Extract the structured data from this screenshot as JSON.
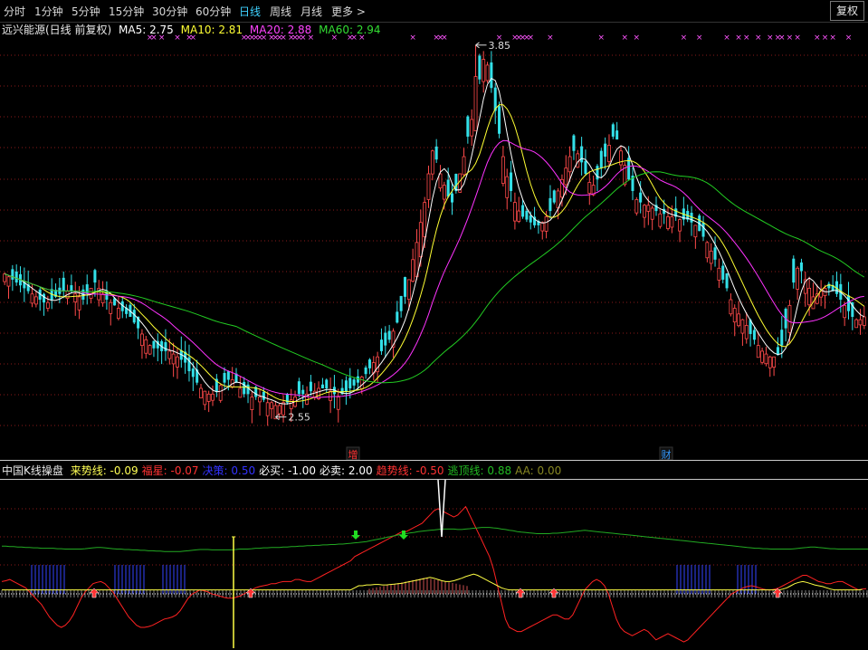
{
  "toolbar": {
    "tabs": [
      {
        "label": "分时",
        "active": false
      },
      {
        "label": "1分钟",
        "active": false
      },
      {
        "label": "5分钟",
        "active": false
      },
      {
        "label": "15分钟",
        "active": false
      },
      {
        "label": "30分钟",
        "active": false
      },
      {
        "label": "60分钟",
        "active": false
      },
      {
        "label": "日线",
        "active": true
      },
      {
        "label": "周线",
        "active": false
      },
      {
        "label": "月线",
        "active": false
      },
      {
        "label": "更多 >",
        "active": false
      }
    ],
    "restore_right_button": "复权"
  },
  "main_legend": {
    "title": "远兴能源(日线 前复权)",
    "ma5": "MA5: 2.75",
    "ma10": "MA10: 2.81",
    "ma20": "MA20: 2.88",
    "ma60": "MA60: 2.94"
  },
  "indicator_legend": {
    "title": "中国K线操盘",
    "items": [
      {
        "text": "来势线: -0.09",
        "color": "#ffff55"
      },
      {
        "text": "福星: -0.07",
        "color": "#ff3333"
      },
      {
        "text": "决策: 0.50",
        "color": "#3333ff"
      },
      {
        "text": "必买: -1.00",
        "color": "#ffffff"
      },
      {
        "text": "必卖: 2.00",
        "color": "#ffffff"
      },
      {
        "text": "趋势线: -0.50",
        "color": "#ff3333"
      },
      {
        "text": "逃顶线: 0.88",
        "color": "#22bb22"
      },
      {
        "text": "AA: 0.00",
        "color": "#888822"
      }
    ]
  },
  "colors": {
    "up": "#ff4a4a",
    "down": "#33e0e8",
    "ma5": "#ffffff",
    "ma10": "#ffff33",
    "ma20": "#ff33ff",
    "ma60": "#22cc22",
    "grid": "#8a1a1a"
  },
  "chart_data": [
    {
      "type": "candlestick",
      "title": "远兴能源(日线 前复权)",
      "y_range": [
        2.4,
        3.9
      ],
      "annotations": [
        {
          "text": "3.85",
          "kind": "high"
        },
        {
          "text": "2.55",
          "kind": "low"
        }
      ],
      "event_markers": [
        {
          "text": "增",
          "color": "#ff3333"
        },
        {
          "text": "财",
          "color": "#3399ff"
        }
      ],
      "closes": [
        3.05,
        3.04,
        3.03,
        3.02,
        3.01,
        3.0,
        2.99,
        2.98,
        2.97,
        2.96,
        2.95,
        2.95,
        2.96,
        2.97,
        2.98,
        2.99,
        2.99,
        2.99,
        2.98,
        2.97,
        2.96,
        2.98,
        3.0,
        3.02,
        3.0,
        2.98,
        2.96,
        2.95,
        2.94,
        2.93,
        2.92,
        2.91,
        2.9,
        2.88,
        2.86,
        2.84,
        2.82,
        2.8,
        2.79,
        2.79,
        2.78,
        2.78,
        2.78,
        2.77,
        2.76,
        2.75,
        2.74,
        2.71,
        2.69,
        2.67,
        2.65,
        2.64,
        2.63,
        2.63,
        2.64,
        2.66,
        2.67,
        2.68,
        2.68,
        2.67,
        2.65,
        2.63,
        2.63,
        2.62,
        2.62,
        2.62,
        2.61,
        2.6,
        2.6,
        2.59,
        2.59,
        2.6,
        2.6,
        2.61,
        2.62,
        2.63,
        2.63,
        2.63,
        2.64,
        2.64,
        2.65,
        2.65,
        2.65,
        2.64,
        2.63,
        2.62,
        2.63,
        2.64,
        2.65,
        2.66,
        2.67,
        2.69,
        2.7,
        2.72,
        2.74,
        2.76,
        2.78,
        2.8,
        2.82,
        2.85,
        2.88,
        2.92,
        2.97,
        3.03,
        3.1,
        3.16,
        3.23,
        3.3,
        3.4,
        3.48,
        3.45,
        3.4,
        3.36,
        3.32,
        3.3,
        3.34,
        3.4,
        3.46,
        3.53,
        3.59,
        3.66,
        3.73,
        3.8,
        3.78,
        3.7,
        3.62,
        3.54,
        3.46,
        3.39,
        3.34,
        3.3,
        3.27,
        3.25,
        3.24,
        3.23,
        3.22,
        3.22,
        3.23,
        3.25,
        3.27,
        3.3,
        3.34,
        3.38,
        3.42,
        3.46,
        3.48,
        3.47,
        3.44,
        3.4,
        3.37,
        3.36,
        3.38,
        3.42,
        3.46,
        3.5,
        3.53,
        3.52,
        3.48,
        3.43,
        3.38,
        3.34,
        3.31,
        3.3,
        3.29,
        3.29,
        3.28,
        3.27,
        3.26,
        3.26,
        3.25,
        3.25,
        3.25,
        3.24,
        3.24,
        3.24,
        3.23,
        3.22,
        3.2,
        3.18,
        3.16,
        3.13,
        3.1,
        3.07,
        3.03,
        3.0,
        2.96,
        2.93,
        2.91,
        2.89,
        2.87,
        2.84,
        2.82,
        2.8,
        2.78,
        2.77,
        2.76,
        2.76,
        2.77,
        2.8,
        2.86,
        2.94,
        3.02,
        3.07,
        3.06,
        3.03,
        3.0,
        2.97,
        2.98,
        2.99,
        3.0,
        3.0,
        2.99,
        2.98,
        2.96,
        2.94,
        2.92,
        2.9,
        2.89,
        2.89,
        2.9
      ]
    },
    {
      "type": "line",
      "title": "中国K线操盘",
      "y_range": [
        -1.5,
        2.5
      ],
      "series": [
        {
          "name": "趋势线",
          "color": "#ff2222",
          "values": [
            0.1,
            0.12,
            0.15,
            0.1,
            0.05,
            0.0,
            -0.05,
            -0.15,
            -0.25,
            -0.35,
            -0.45,
            -0.6,
            -0.75,
            -0.85,
            -0.95,
            -1.0,
            -0.95,
            -0.85,
            -0.7,
            -0.5,
            -0.3,
            -0.15,
            -0.05,
            0.05,
            0.08,
            0.1,
            0.05,
            -0.05,
            -0.15,
            -0.3,
            -0.45,
            -0.6,
            -0.75,
            -0.85,
            -0.95,
            -1.0,
            -1.0,
            -0.98,
            -0.95,
            -0.9,
            -0.85,
            -0.8,
            -0.78,
            -0.75,
            -0.7,
            -0.6,
            -0.45,
            -0.3,
            -0.2,
            -0.15,
            -0.1,
            -0.12,
            -0.15,
            -0.2,
            -0.22,
            -0.25,
            -0.28,
            -0.3,
            -0.3,
            -0.28,
            -0.25,
            -0.2,
            -0.15,
            -0.1,
            -0.05,
            -0.02,
            0.0,
            0.02,
            0.05,
            0.05,
            0.08,
            0.1,
            0.1,
            0.1,
            0.15,
            0.15,
            0.12,
            0.1,
            0.1,
            0.15,
            0.2,
            0.25,
            0.3,
            0.35,
            0.4,
            0.45,
            0.5,
            0.55,
            0.6,
            0.7,
            0.75,
            0.8,
            0.85,
            0.9,
            0.95,
            1.0,
            1.05,
            1.1,
            1.15,
            1.2,
            1.25,
            1.3,
            1.3,
            1.35,
            1.4,
            1.45,
            1.5,
            1.6,
            1.7,
            1.8,
            1.85,
            1.8,
            1.75,
            1.7,
            1.65,
            1.7,
            1.8,
            1.9,
            1.7,
            1.5,
            1.3,
            1.1,
            0.9,
            0.7,
            0.4,
            0.0,
            -0.4,
            -0.8,
            -1.0,
            -1.05,
            -1.1,
            -1.1,
            -1.05,
            -1.0,
            -0.95,
            -0.9,
            -0.85,
            -0.8,
            -0.75,
            -0.7,
            -0.7,
            -0.75,
            -0.8,
            -0.8,
            -0.7,
            -0.5,
            -0.3,
            -0.1,
            0.0,
            0.1,
            0.15,
            0.1,
            0.0,
            -0.2,
            -0.5,
            -0.8,
            -1.0,
            -1.1,
            -1.15,
            -1.2,
            -1.15,
            -1.1,
            -1.05,
            -1.1,
            -1.2,
            -1.3,
            -1.25,
            -1.2,
            -1.15,
            -1.2,
            -1.25,
            -1.3,
            -1.35,
            -1.3,
            -1.2,
            -1.1,
            -1.0,
            -0.9,
            -0.8,
            -0.7,
            -0.6,
            -0.5,
            -0.4,
            -0.3,
            -0.2,
            -0.15,
            -0.1,
            -0.05,
            -0.02,
            0.0,
            -0.02,
            -0.05,
            -0.08,
            -0.1,
            -0.1,
            -0.08,
            -0.05,
            0.0,
            0.05,
            0.1,
            0.15,
            0.2,
            0.25,
            0.25,
            0.2,
            0.15,
            0.1,
            0.08,
            0.05,
            0.05,
            0.08,
            0.1,
            0.1,
            0.05,
            0.0,
            -0.05,
            -0.1,
            -0.08,
            -0.07
          ]
        },
        {
          "name": "逃顶线",
          "color": "#22aa22",
          "values": [
            0.95,
            0.95,
            0.94,
            0.94,
            0.93,
            0.93,
            0.92,
            0.92,
            0.91,
            0.91,
            0.9,
            0.9,
            0.9,
            0.9,
            0.89,
            0.89,
            0.88,
            0.88,
            0.88,
            0.88,
            0.88,
            0.89,
            0.9,
            0.91,
            0.92,
            0.92,
            0.91,
            0.9,
            0.89,
            0.88,
            0.88,
            0.87,
            0.87,
            0.86,
            0.86,
            0.85,
            0.85,
            0.84,
            0.84,
            0.83,
            0.83,
            0.82,
            0.82,
            0.82,
            0.82,
            0.82,
            0.83,
            0.84,
            0.85,
            0.86,
            0.87,
            0.87,
            0.87,
            0.86,
            0.86,
            0.86,
            0.86,
            0.86,
            0.86,
            0.87,
            0.88,
            0.88,
            0.88,
            0.89,
            0.9,
            0.9,
            0.91,
            0.91,
            0.92,
            0.92,
            0.92,
            0.93,
            0.93,
            0.94,
            0.94,
            0.95,
            0.95,
            0.96,
            0.96,
            0.97,
            0.97,
            0.98,
            0.98,
            0.99,
            0.99,
            1.0,
            1.0,
            1.01,
            1.02,
            1.03,
            1.04,
            1.05,
            1.06,
            1.08,
            1.1,
            1.12,
            1.14,
            1.16,
            1.18,
            1.2,
            1.22,
            1.24,
            1.25,
            1.27,
            1.28,
            1.3,
            1.31,
            1.32,
            1.33,
            1.34,
            1.35,
            1.36,
            1.36,
            1.36,
            1.36,
            1.35,
            1.35,
            1.36,
            1.37,
            1.38,
            1.39,
            1.4,
            1.4,
            1.4,
            1.39,
            1.38,
            1.36,
            1.35,
            1.33,
            1.32,
            1.3,
            1.29,
            1.28,
            1.27,
            1.26,
            1.25,
            1.25,
            1.25,
            1.25,
            1.26,
            1.26,
            1.27,
            1.28,
            1.29,
            1.3,
            1.31,
            1.32,
            1.33,
            1.32,
            1.31,
            1.3,
            1.29,
            1.28,
            1.27,
            1.26,
            1.25,
            1.24,
            1.23,
            1.22,
            1.21,
            1.2,
            1.19,
            1.18,
            1.17,
            1.16,
            1.15,
            1.14,
            1.13,
            1.12,
            1.11,
            1.1,
            1.09,
            1.08,
            1.07,
            1.06,
            1.05,
            1.04,
            1.03,
            1.02,
            1.01,
            1.0,
            0.99,
            0.98,
            0.97,
            0.96,
            0.95,
            0.94,
            0.93,
            0.92,
            0.91,
            0.9,
            0.9,
            0.89,
            0.89,
            0.88,
            0.88,
            0.88,
            0.88,
            0.88,
            0.88,
            0.89,
            0.9,
            0.91,
            0.92,
            0.93,
            0.93,
            0.92,
            0.91,
            0.9,
            0.89,
            0.89,
            0.88,
            0.88,
            0.88,
            0.88,
            0.88,
            0.88,
            0.88,
            0.88,
            0.88,
            0.88,
            0.88
          ]
        },
        {
          "name": "来势线",
          "color": "#ffff44",
          "values": [
            -0.1,
            -0.1,
            -0.1,
            -0.1,
            -0.1,
            -0.1,
            -0.1,
            -0.1,
            -0.1,
            -0.1,
            -0.1,
            -0.1,
            -0.1,
            -0.1,
            -0.1,
            -0.1,
            -0.1,
            -0.1,
            -0.1,
            -0.1,
            -0.1,
            -0.1,
            -0.1,
            -0.1,
            -0.1,
            -0.1,
            -0.1,
            -0.1,
            -0.1,
            -0.1,
            -0.1,
            -0.1,
            -0.1,
            -0.1,
            -0.1,
            -0.1,
            -0.1,
            -0.1,
            -0.1,
            -0.1,
            -0.1,
            -0.1,
            -0.1,
            -0.1,
            -0.1,
            -0.1,
            -0.1,
            -0.1,
            -0.1,
            -0.1,
            -0.1,
            -0.1,
            -0.1,
            -0.1,
            -0.1,
            -0.1,
            -0.1,
            -0.1,
            -0.1,
            -0.1,
            -0.1,
            -0.1,
            -0.1,
            -0.1,
            -0.1,
            -0.1,
            -0.1,
            -0.1,
            -0.1,
            -0.1,
            -0.1,
            -0.1,
            -0.1,
            -0.1,
            -0.1,
            -0.1,
            -0.1,
            -0.1,
            -0.1,
            -0.1,
            -0.1,
            -0.1,
            -0.1,
            -0.1,
            -0.1,
            -0.1,
            -0.1,
            -0.1,
            -0.1,
            -0.05,
            0.0,
            0.0,
            0.02,
            0.02,
            0.03,
            0.03,
            0.02,
            0.02,
            0.03,
            0.04,
            0.05,
            0.06,
            0.08,
            0.1,
            0.12,
            0.14,
            0.16,
            0.18,
            0.2,
            0.18,
            0.15,
            0.12,
            0.1,
            0.1,
            0.12,
            0.15,
            0.18,
            0.22,
            0.25,
            0.28,
            0.25,
            0.2,
            0.15,
            0.1,
            0.05,
            0.0,
            -0.05,
            -0.08,
            -0.1,
            -0.1,
            -0.1,
            -0.1,
            -0.1,
            -0.1,
            -0.1,
            -0.1,
            -0.1,
            -0.1,
            -0.1,
            -0.1,
            -0.1,
            -0.1,
            -0.1,
            -0.1,
            -0.1,
            -0.1,
            -0.1,
            -0.1,
            -0.1,
            -0.1,
            -0.1,
            -0.1,
            -0.1,
            -0.1,
            -0.1,
            -0.1,
            -0.1,
            -0.1,
            -0.1,
            -0.1,
            -0.1,
            -0.1,
            -0.1,
            -0.1,
            -0.1,
            -0.1,
            -0.1,
            -0.1,
            -0.1,
            -0.1,
            -0.1,
            -0.1,
            -0.1,
            -0.1,
            -0.1,
            -0.1,
            -0.1,
            -0.1,
            -0.1,
            -0.1,
            -0.1,
            -0.1,
            -0.1,
            -0.1,
            -0.1,
            -0.1,
            -0.1,
            -0.1,
            -0.1,
            -0.1,
            -0.1,
            -0.1,
            -0.1,
            -0.1,
            -0.1,
            -0.1,
            -0.1,
            -0.08,
            -0.05,
            0.0,
            0.05,
            0.08,
            0.1,
            0.08,
            0.05,
            0.02,
            0.0,
            -0.02,
            -0.05,
            -0.08,
            -0.1,
            -0.1,
            -0.1,
            -0.1,
            -0.1,
            -0.1,
            -0.1,
            -0.09
          ]
        }
      ]
    }
  ]
}
